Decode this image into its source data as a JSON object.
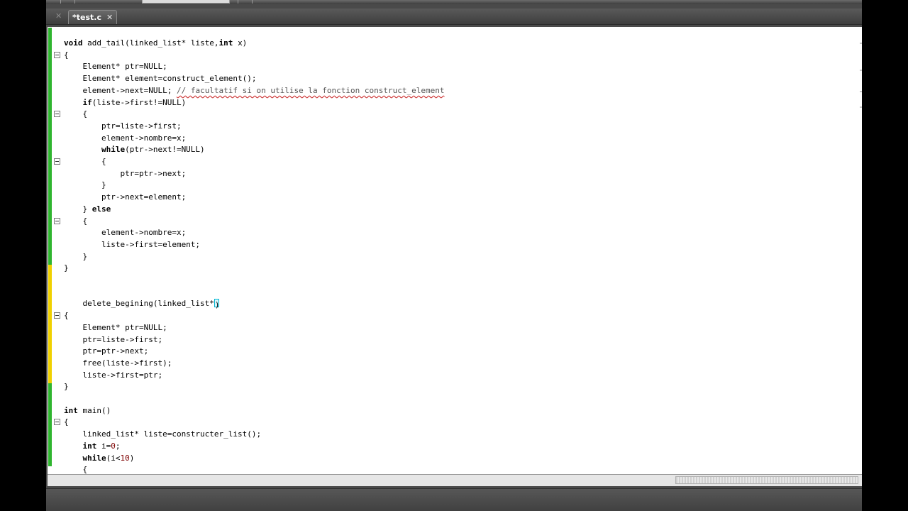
{
  "tabs": [
    {
      "label": "*test.c",
      "icon": "close-icon"
    }
  ],
  "editor": {
    "lines": [
      [
        {
          "t": "kw",
          "v": "void "
        },
        {
          "t": "id",
          "v": "add_tail(linked_list* liste,"
        },
        {
          "t": "kw",
          "v": "int "
        },
        {
          "t": "id",
          "v": "x)"
        }
      ],
      [
        {
          "t": "op",
          "v": "{"
        }
      ],
      [
        {
          "t": "id",
          "v": "    Element* ptr=NULL;"
        }
      ],
      [
        {
          "t": "id",
          "v": "    Element* element=construct_element();"
        }
      ],
      [
        {
          "t": "id",
          "v": "    element->next=NULL; "
        },
        {
          "t": "cmt",
          "v": "// facultatif si on utilise la fonction construct_element"
        }
      ],
      [
        {
          "t": "kw",
          "v": "    if"
        },
        {
          "t": "id",
          "v": "(liste->first!=NULL)"
        }
      ],
      [
        {
          "t": "op",
          "v": "    {"
        }
      ],
      [
        {
          "t": "id",
          "v": "        ptr=liste->first;"
        }
      ],
      [
        {
          "t": "id",
          "v": "        element->nombre=x;"
        }
      ],
      [
        {
          "t": "kw",
          "v": "        while"
        },
        {
          "t": "id",
          "v": "(ptr->next!=NULL)"
        }
      ],
      [
        {
          "t": "op",
          "v": "        {"
        }
      ],
      [
        {
          "t": "id",
          "v": "            ptr=ptr->next;"
        }
      ],
      [
        {
          "t": "op",
          "v": "        }"
        }
      ],
      [
        {
          "t": "id",
          "v": "        ptr->next=element;"
        }
      ],
      [
        {
          "t": "op",
          "v": "    } "
        },
        {
          "t": "kw",
          "v": "else"
        }
      ],
      [
        {
          "t": "op",
          "v": "    {"
        }
      ],
      [
        {
          "t": "id",
          "v": "        element->nombre=x;"
        }
      ],
      [
        {
          "t": "id",
          "v": "        liste->first=element;"
        }
      ],
      [
        {
          "t": "op",
          "v": "    }"
        }
      ],
      [
        {
          "t": "op",
          "v": "}"
        }
      ],
      [],
      [],
      [
        {
          "t": "id",
          "v": "    delete_begining(linked_list*"
        },
        {
          "t": "caret",
          "v": ")"
        }
      ],
      [
        {
          "t": "op",
          "v": "{"
        }
      ],
      [
        {
          "t": "id",
          "v": "    Element* ptr=NULL;"
        }
      ],
      [
        {
          "t": "id",
          "v": "    ptr=liste->first;"
        }
      ],
      [
        {
          "t": "id",
          "v": "    ptr=ptr->next;"
        }
      ],
      [
        {
          "t": "id",
          "v": "    free(liste->first);"
        }
      ],
      [
        {
          "t": "id",
          "v": "    liste->first=ptr;"
        }
      ],
      [
        {
          "t": "op",
          "v": "}"
        }
      ],
      [],
      [
        {
          "t": "kw",
          "v": "int "
        },
        {
          "t": "id",
          "v": "main()"
        }
      ],
      [
        {
          "t": "op",
          "v": "{"
        }
      ],
      [
        {
          "t": "id",
          "v": "    linked_list* liste=constructer_list();"
        }
      ],
      [
        {
          "t": "kw",
          "v": "    int "
        },
        {
          "t": "id",
          "v": "i="
        },
        {
          "t": "num",
          "v": "0"
        },
        {
          "t": "id",
          "v": ";"
        }
      ],
      [
        {
          "t": "kw",
          "v": "    while"
        },
        {
          "t": "id",
          "v": "(i<"
        },
        {
          "t": "num",
          "v": "10"
        },
        {
          "t": "id",
          "v": ")"
        }
      ],
      [
        {
          "t": "op",
          "v": "    {"
        }
      ]
    ],
    "change_markers": [
      {
        "from_line": 0,
        "to_line": 19,
        "color": "#2fb52f"
      },
      {
        "from_line": 20,
        "to_line": 29,
        "color": "#f0d000"
      },
      {
        "from_line": 30,
        "to_line": 36,
        "color": "#2fb52f"
      }
    ],
    "fold_markers": [
      1,
      6,
      10,
      15,
      23,
      32
    ]
  }
}
